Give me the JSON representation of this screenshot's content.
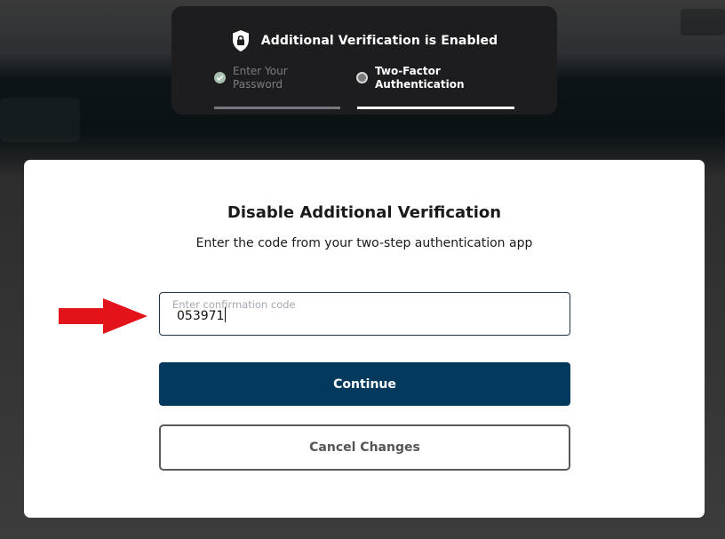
{
  "stepper": {
    "title": "Additional Verification is Enabled",
    "steps": [
      {
        "label": "Enter Your Password",
        "status": "completed"
      },
      {
        "label": "Two-Factor Authentication",
        "status": "active"
      }
    ]
  },
  "modal": {
    "title": "Disable Additional Verification",
    "subtitle": "Enter the code from your two-step authentication app",
    "code_field": {
      "placeholder": "Enter confirmation code",
      "value": "053971"
    },
    "continue_label": "Continue",
    "cancel_label": "Cancel Changes"
  },
  "colors": {
    "primary": "#04395e",
    "arrow": "#e3131a",
    "step_done": "#a9bfb0"
  },
  "icons": {
    "header": "shield-lock-icon",
    "step_done": "check-icon",
    "annotation": "red-arrow-icon"
  }
}
